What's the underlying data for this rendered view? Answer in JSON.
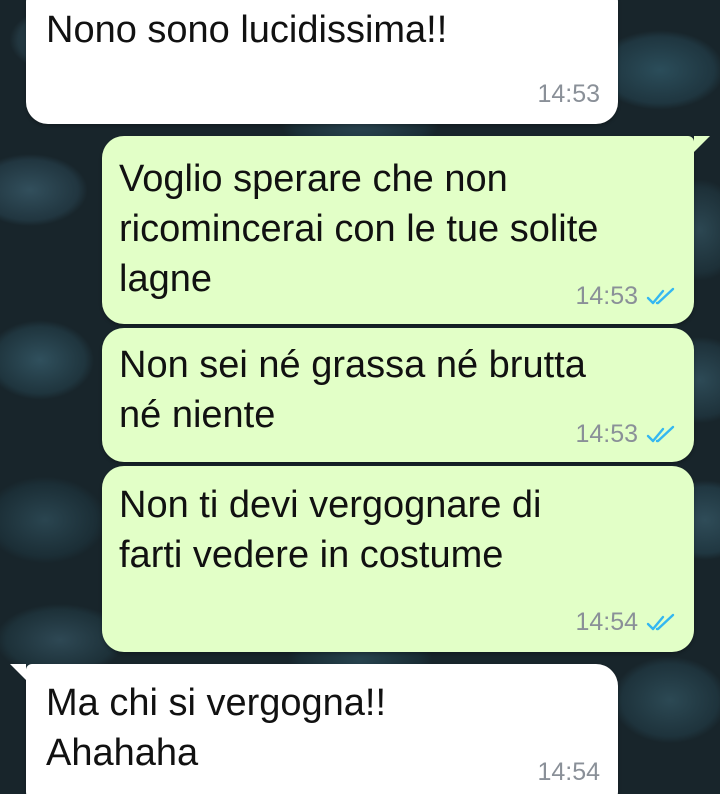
{
  "messages": [
    {
      "direction": "incoming",
      "text": "Nono sono lucidissima!!",
      "time": "14:53"
    },
    {
      "direction": "outgoing",
      "text": "Voglio sperare che non\nricomincerai con le tue solite\nlagne",
      "time": "14:53",
      "status_icon": "double-check-read-icon"
    },
    {
      "direction": "outgoing",
      "text": "Non sei né grassa né brutta\nné niente",
      "time": "14:53",
      "status_icon": "double-check-read-icon"
    },
    {
      "direction": "outgoing",
      "text": "Non ti devi vergognare di\nfarti vedere in costume",
      "time": "14:54",
      "status_icon": "double-check-read-icon"
    },
    {
      "direction": "incoming",
      "text": "Ma chi si vergogna!!\nAhahaha",
      "time": "14:54"
    }
  ],
  "colors": {
    "incoming_bubble": "#ffffff",
    "outgoing_bubble": "#e2ffc7",
    "read_ticks": "#34b7f1",
    "timestamp": "#8a9098"
  }
}
